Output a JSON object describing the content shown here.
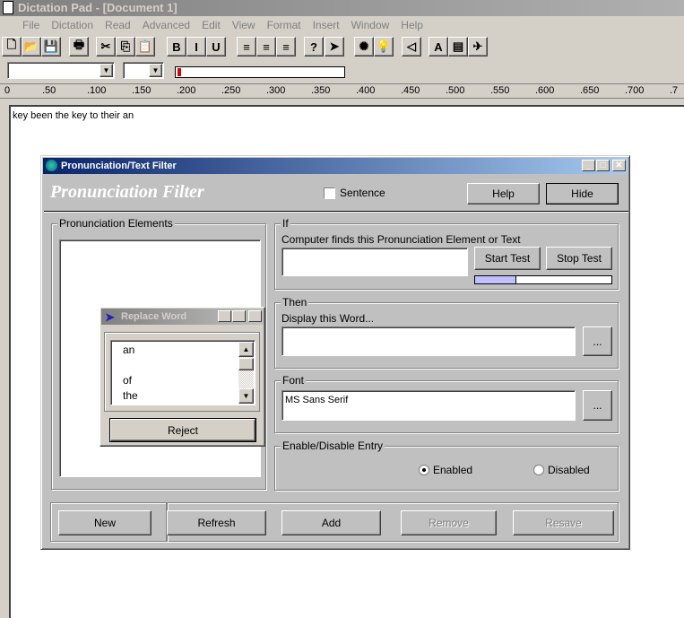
{
  "app": {
    "title": "Dictation Pad - [Document 1]",
    "menu": [
      "File",
      "Dictation",
      "Read",
      "Advanced",
      "Edit",
      "View",
      "Format",
      "Insert",
      "Window",
      "Help"
    ],
    "toolbar": [
      {
        "icon": "new-icon",
        "g": "🗋"
      },
      {
        "icon": "open-icon",
        "g": "📂"
      },
      {
        "icon": "save-icon",
        "g": "💾"
      },
      {
        "icon": "print-icon",
        "g": "🖶"
      },
      {
        "icon": "cut-icon",
        "g": "✂"
      },
      {
        "icon": "copy-icon",
        "g": "⎘"
      },
      {
        "icon": "paste-icon",
        "g": "📋"
      },
      {
        "icon": "bold-icon",
        "g": "B"
      },
      {
        "icon": "italic-icon",
        "g": "I"
      },
      {
        "icon": "underline-icon",
        "g": "U"
      },
      {
        "icon": "align-left-icon",
        "g": "≡"
      },
      {
        "icon": "align-center-icon",
        "g": "≡"
      },
      {
        "icon": "align-right-icon",
        "g": "≡"
      },
      {
        "icon": "help-icon",
        "g": "?"
      },
      {
        "icon": "cursor-icon",
        "g": "➤"
      },
      {
        "icon": "microphone-red-icon",
        "g": "✺"
      },
      {
        "icon": "lightbulb-icon",
        "g": "💡"
      },
      {
        "icon": "speaker-icon",
        "g": "◁"
      },
      {
        "icon": "text-icon",
        "g": "A"
      },
      {
        "icon": "clipboard-icon",
        "g": "▤"
      },
      {
        "icon": "plane-icon",
        "g": "✈"
      }
    ],
    "ruler": [
      "0",
      ".50",
      ".100",
      ".150",
      ".200",
      ".250",
      ".300",
      ".350",
      ".400",
      ".450",
      ".500",
      ".550",
      ".600",
      ".650",
      ".700",
      ".7"
    ],
    "document_text": "key been the key to their an"
  },
  "dialog": {
    "title": "Pronunciation/Text Filter",
    "heading": "Pronunciation Filter",
    "sentence_label": "Sentence",
    "sentence_checked": false,
    "help": "Help",
    "hide": "Hide",
    "elements_label": "Pronunciation Elements",
    "if_label": "If",
    "if_desc": "Computer finds this Pronunciation Element or Text",
    "if_value": "",
    "start_test": "Start Test",
    "stop_test": "Stop Test",
    "test_progress": 0.3,
    "then_label": "Then",
    "then_desc": "Display this Word...",
    "then_value": "",
    "browse": "...",
    "font_label": "Font",
    "font_value": "MS Sans Serif",
    "enable_label": "Enable/Disable Entry",
    "enabled": "Enabled",
    "disabled": "Disabled",
    "selected": "Enabled",
    "buttons": {
      "new": "New",
      "refresh": "Refresh",
      "add": "Add",
      "remove": "Remove",
      "resave": "Resave"
    }
  },
  "replace": {
    "title": "Replace Word",
    "items": [
      "an",
      "",
      "of",
      "the"
    ],
    "reject": "Reject"
  },
  "colors": {
    "dialog_title_start": "#0a246a",
    "dialog_title_end": "#a6caf0",
    "progress_fill": "#c0c0ff"
  }
}
